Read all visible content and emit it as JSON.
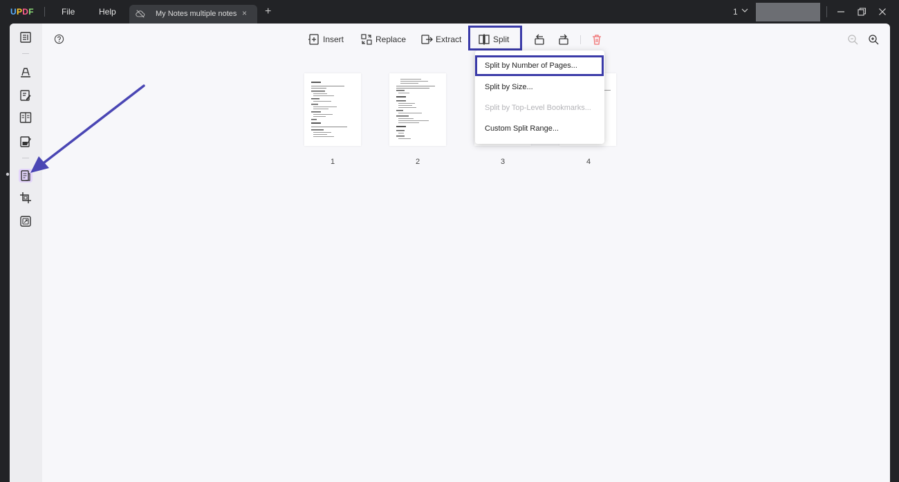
{
  "app": {
    "logo": "UPDF",
    "menu": [
      "File",
      "Help"
    ],
    "tab_title": "My Notes multiple notes",
    "tab_close": "×",
    "tab_add": "+",
    "window_count": "1"
  },
  "toolbar": {
    "insert_label": "Insert",
    "replace_label": "Replace",
    "extract_label": "Extract",
    "split_label": "Split"
  },
  "pages": [
    {
      "number": "1"
    },
    {
      "number": "2"
    },
    {
      "number": "3"
    },
    {
      "number": "4"
    }
  ],
  "split_menu": {
    "items": [
      {
        "label": "Split by Number of Pages...",
        "enabled": true,
        "highlighted": true
      },
      {
        "label": "Split by Size...",
        "enabled": true
      },
      {
        "label": "Split by Top-Level Bookmarks...",
        "enabled": false
      },
      {
        "label": "Custom Split Range...",
        "enabled": true
      }
    ]
  },
  "colors": {
    "highlight_box": "#3a3aa8",
    "annotation_arrow": "#4a46b4",
    "active_sidebar": "#e3d4fb",
    "delete_icon": "#f07070"
  }
}
